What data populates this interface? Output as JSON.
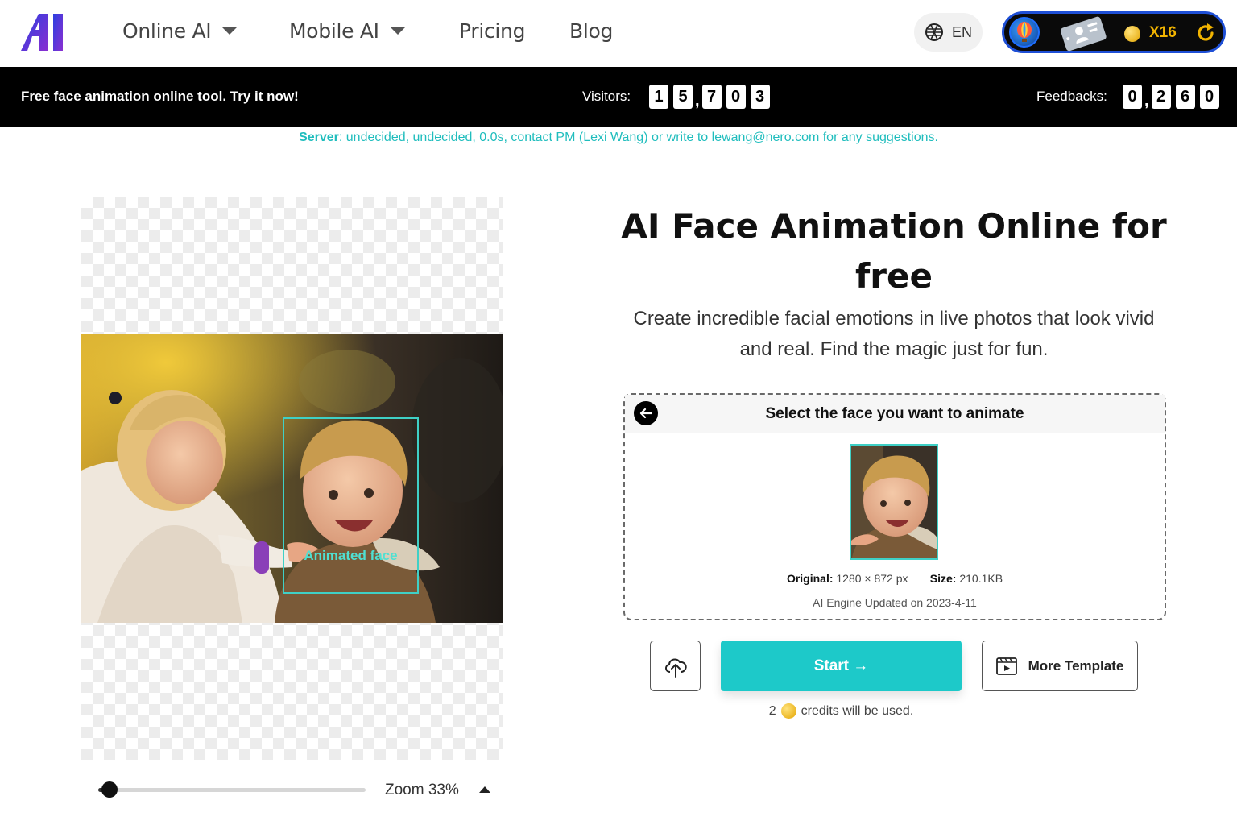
{
  "nav": {
    "items": [
      {
        "label": "Online AI",
        "has_dropdown": true
      },
      {
        "label": "Mobile AI",
        "has_dropdown": true
      },
      {
        "label": "Pricing",
        "has_dropdown": false
      },
      {
        "label": "Blog",
        "has_dropdown": false
      }
    ],
    "language": "EN",
    "credits_badge": "X16",
    "colors": {
      "accent": "#1dc9c9",
      "logo_start": "#1b3bd6",
      "logo_end": "#7a2fd0",
      "credit_gold": "#f2b400"
    }
  },
  "banner": {
    "text": "Free face animation online tool. Try it now!",
    "visitors_label": "Visitors:",
    "visitors_digits": [
      "1",
      "5",
      ",",
      "7",
      "0",
      "3"
    ],
    "feedbacks_label": "Feedbacks:",
    "feedbacks_digits": [
      "0",
      ",",
      "2",
      "6",
      "0"
    ]
  },
  "server": {
    "label": "Server",
    "text": ": undecided, undecided, 0.0s, contact PM (Lexi Wang) or write to lewang@nero.com for any suggestions."
  },
  "canvas": {
    "face_label": "Animated face",
    "zoom_text": "Zoom 33%",
    "zoom_level": 0.33
  },
  "hero": {
    "title": "AI Face Animation Online for free",
    "subtitle": "Create incredible facial emotions in live photos that look vivid and real. Find the magic just for fun."
  },
  "select": {
    "title": "Select the face you want to animate",
    "original_label": "Original:",
    "original_value": "1280 × 872 px",
    "size_label": "Size:",
    "size_value": "210.1KB",
    "engine_text": "AI Engine Updated on 2023-4-11"
  },
  "actions": {
    "start_label": "Start →",
    "template_label": "More Template",
    "credits_count": "2",
    "credits_text": "credits will be used."
  }
}
